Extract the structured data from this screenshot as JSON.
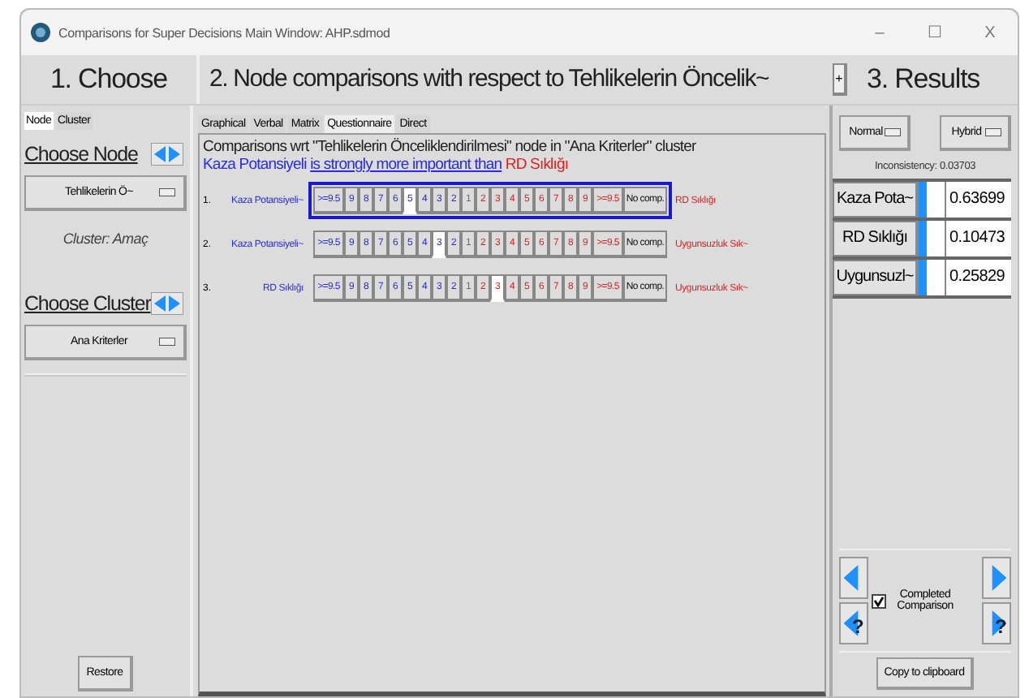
{
  "window": {
    "title": "Comparisons for Super Decisions Main Window: AHP.sdmod",
    "controls": [
      "–",
      "☐",
      "X"
    ]
  },
  "headers": {
    "choose": "1. Choose",
    "comparisons": "2. Node comparisons with respect to Tehlikelerin Öncelik~",
    "expand": "+",
    "results": "3. Results"
  },
  "left": {
    "tabs": [
      {
        "label": "Node",
        "selected": true
      },
      {
        "label": "Cluster",
        "selected": false
      }
    ],
    "choose_node": "Choose Node",
    "node_dropdown": "Tehlikelerin Ö~",
    "cluster_label": "Cluster: Amaç",
    "choose_cluster": "Choose Cluster",
    "cluster_dropdown": "Ana Kriterler",
    "restore": "Restore"
  },
  "middle": {
    "tabs": [
      {
        "label": "Graphical",
        "selected": false
      },
      {
        "label": "Verbal",
        "selected": false
      },
      {
        "label": "Matrix",
        "selected": false
      },
      {
        "label": "Questionnaire",
        "selected": true
      },
      {
        "label": "Direct",
        "selected": false
      }
    ],
    "heading": "Comparisons wrt \"Tehlikelerin Önceliklendirilmesi\" node in \"Ana Kriterler\" cluster",
    "statement": {
      "left": "Kaza Potansiyeli",
      "middle": "is strongly more important than",
      "right": "RD Sıklığı"
    },
    "rows": [
      {
        "number": "1.",
        "left": "Kaza Potansiyeli~",
        "right": "RD Sıklığı",
        "current": true,
        "no_comp": "No comp.",
        "cells": [
          {
            "label": ">=9.5",
            "kind": "left",
            "selected": false
          },
          {
            "label": "9",
            "kind": "left",
            "selected": false
          },
          {
            "label": "8",
            "kind": "left",
            "selected": false
          },
          {
            "label": "7",
            "kind": "left",
            "selected": false
          },
          {
            "label": "6",
            "kind": "left",
            "selected": false
          },
          {
            "label": "5",
            "kind": "left",
            "selected": true
          },
          {
            "label": "4",
            "kind": "left",
            "selected": false
          },
          {
            "label": "3",
            "kind": "left",
            "selected": false
          },
          {
            "label": "2",
            "kind": "left",
            "selected": false
          },
          {
            "label": "1",
            "kind": "mid",
            "selected": false
          },
          {
            "label": "2",
            "kind": "right",
            "selected": false
          },
          {
            "label": "3",
            "kind": "right",
            "selected": false
          },
          {
            "label": "4",
            "kind": "right",
            "selected": false
          },
          {
            "label": "5",
            "kind": "right",
            "selected": false
          },
          {
            "label": "6",
            "kind": "right",
            "selected": false
          },
          {
            "label": "7",
            "kind": "right",
            "selected": false
          },
          {
            "label": "8",
            "kind": "right",
            "selected": false
          },
          {
            "label": "9",
            "kind": "right",
            "selected": false
          },
          {
            "label": ">=9.5",
            "kind": "right",
            "selected": false
          }
        ]
      },
      {
        "number": "2.",
        "left": "Kaza Potansiyeli~",
        "right": "Uygunsuzluk Sık~",
        "current": false,
        "no_comp": "No comp.",
        "cells": [
          {
            "label": ">=9.5",
            "kind": "left",
            "selected": false
          },
          {
            "label": "9",
            "kind": "left",
            "selected": false
          },
          {
            "label": "8",
            "kind": "left",
            "selected": false
          },
          {
            "label": "7",
            "kind": "left",
            "selected": false
          },
          {
            "label": "6",
            "kind": "left",
            "selected": false
          },
          {
            "label": "5",
            "kind": "left",
            "selected": false
          },
          {
            "label": "4",
            "kind": "left",
            "selected": false
          },
          {
            "label": "3",
            "kind": "left",
            "selected": true
          },
          {
            "label": "2",
            "kind": "left",
            "selected": false
          },
          {
            "label": "1",
            "kind": "mid",
            "selected": false
          },
          {
            "label": "2",
            "kind": "right",
            "selected": false
          },
          {
            "label": "3",
            "kind": "right",
            "selected": false
          },
          {
            "label": "4",
            "kind": "right",
            "selected": false
          },
          {
            "label": "5",
            "kind": "right",
            "selected": false
          },
          {
            "label": "6",
            "kind": "right",
            "selected": false
          },
          {
            "label": "7",
            "kind": "right",
            "selected": false
          },
          {
            "label": "8",
            "kind": "right",
            "selected": false
          },
          {
            "label": "9",
            "kind": "right",
            "selected": false
          },
          {
            "label": ">=9.5",
            "kind": "right",
            "selected": false
          }
        ]
      },
      {
        "number": "3.",
        "left": "RD Sıklığı",
        "right": "Uygunsuzluk Sık~",
        "current": false,
        "no_comp": "No comp.",
        "cells": [
          {
            "label": ">=9.5",
            "kind": "left",
            "selected": false
          },
          {
            "label": "9",
            "kind": "left",
            "selected": false
          },
          {
            "label": "8",
            "kind": "left",
            "selected": false
          },
          {
            "label": "7",
            "kind": "left",
            "selected": false
          },
          {
            "label": "6",
            "kind": "left",
            "selected": false
          },
          {
            "label": "5",
            "kind": "left",
            "selected": false
          },
          {
            "label": "4",
            "kind": "left",
            "selected": false
          },
          {
            "label": "3",
            "kind": "left",
            "selected": false
          },
          {
            "label": "2",
            "kind": "left",
            "selected": false
          },
          {
            "label": "1",
            "kind": "mid",
            "selected": false
          },
          {
            "label": "2",
            "kind": "right",
            "selected": false
          },
          {
            "label": "3",
            "kind": "right",
            "selected": true
          },
          {
            "label": "4",
            "kind": "right",
            "selected": false
          },
          {
            "label": "5",
            "kind": "right",
            "selected": false
          },
          {
            "label": "6",
            "kind": "right",
            "selected": false
          },
          {
            "label": "7",
            "kind": "right",
            "selected": false
          },
          {
            "label": "8",
            "kind": "right",
            "selected": false
          },
          {
            "label": "9",
            "kind": "right",
            "selected": false
          },
          {
            "label": ">=9.5",
            "kind": "right",
            "selected": false
          }
        ]
      }
    ]
  },
  "right": {
    "mode_dropdowns": [
      "Normal",
      "Hybrid"
    ],
    "inconsistency": "Inconsistency: 0.03703",
    "results": [
      {
        "name": "Kaza Pota~",
        "value": "0.63699"
      },
      {
        "name": "RD Sıklığı",
        "value": "0.10473"
      },
      {
        "name": "Uygunsuzl~",
        "value": "0.25829"
      }
    ],
    "nav": [
      {
        "kind": "prev"
      },
      {
        "kind": "next"
      },
      {
        "kind": "prev-help",
        "mark": "?"
      },
      {
        "kind": "next-help",
        "mark": "?"
      }
    ],
    "completed": {
      "label": "Completed Comparison",
      "checked": true
    },
    "copy": "Copy to clipboard"
  }
}
